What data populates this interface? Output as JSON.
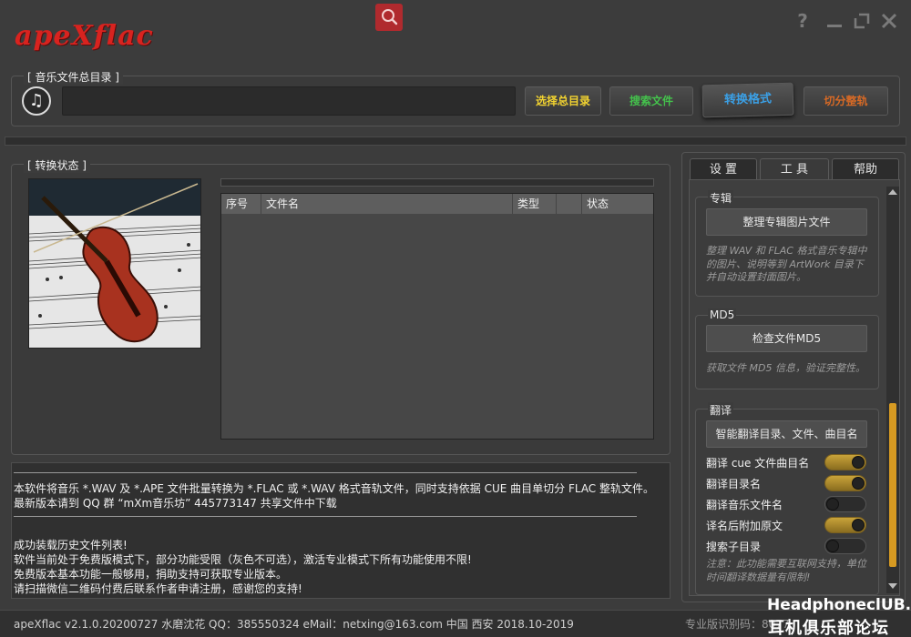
{
  "app": {
    "logo_text": "apeXflac",
    "accent_color": "#d8231f"
  },
  "toolbar": {
    "help_icon": "?",
    "icons": [
      "search-icon",
      "help-icon",
      "minimize-icon",
      "maximize-icon",
      "close-icon"
    ]
  },
  "music_dir": {
    "group_title": "[ 音乐文件总目录 ]",
    "path_value": "",
    "btn_select": "选择总目录",
    "btn_search": "搜索文件",
    "btn_convert": "转换格式",
    "btn_split": "切分整轨"
  },
  "status": {
    "group_title": "[ 转换状态 ]",
    "columns": [
      "序号",
      "文件名",
      "类型",
      "",
      "状态"
    ],
    "rows": []
  },
  "log": {
    "lines": [
      "本软件将音乐 *.WAV 及 *.APE 文件批量转换为 *.FLAC 或 *.WAV 格式音轨文件，同时支持依据 CUE 曲目单切分 FLAC 整轨文件。",
      "最新版本请到 QQ 群 “mXm音乐坊” 445773147 共享文件中下载",
      "成功装载历史文件列表!",
      "软件当前处于免费版模式下，部分功能受限（灰色不可选），激活专业模式下所有功能使用不限!",
      "免费版本基本功能一般够用，捐助支持可获取专业版本。",
      "请扫描微信二维码付费后联系作者申请注册，感谢您的支持!"
    ]
  },
  "tools": {
    "tabs": [
      "设 置",
      "工 具",
      "帮助"
    ],
    "active_tab": "工 具",
    "album": {
      "title": "专辑",
      "button": "整理专辑图片文件",
      "desc": "整理 WAV 和 FLAC 格式音乐专辑中的图片、说明等到 ArtWork 目录下并自动设置封面图片。"
    },
    "md5": {
      "title": "MD5",
      "button": "检查文件MD5",
      "desc": "获取文件 MD5 信息，验证完整性。"
    },
    "translate": {
      "title": "翻译",
      "button": "智能翻译目录、文件、曲目名",
      "toggles": [
        {
          "label": "翻译 cue 文件曲目名",
          "on": true
        },
        {
          "label": "翻译目录名",
          "on": true
        },
        {
          "label": "翻译音乐文件名",
          "on": false
        },
        {
          "label": "译名后附加原文",
          "on": true
        },
        {
          "label": "搜索子目录",
          "on": false
        }
      ],
      "note": "注意：此功能需要互联网支持，单位时间翻译数据量有限制!"
    }
  },
  "footer": {
    "info": "apeXflac v2.1.0.20200727 水磨沈花 QQ：385550324 eMail：netxing@163.com  中国 西安 2018.10-2019",
    "serial_label": "专业版识别码：8077",
    "watermark_top": "HeadphoneclUB.com",
    "watermark_bottom": "耳机俱乐部论坛"
  }
}
